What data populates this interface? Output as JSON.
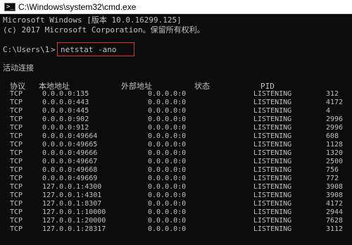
{
  "window": {
    "title": "C:\\Windows\\system32\\cmd.exe",
    "icon": "console-icon"
  },
  "console": {
    "banner_line1": "Microsoft Windows [版本 10.0.16299.125]",
    "banner_line2": "(c) 2017 Microsoft Corporation。保留所有权利。",
    "prompt": "C:\\Users\\1",
    "command": "netstat -ano",
    "section_title": "活动连接",
    "headers": {
      "proto": "协议",
      "local": "本地地址",
      "foreign": "外部地址",
      "state": "状态",
      "pid": "PID"
    },
    "rows": [
      {
        "proto": "TCP",
        "local": "0.0.0.0:135",
        "foreign": "0.0.0.0:0",
        "state": "LISTENING",
        "pid": "312"
      },
      {
        "proto": "TCP",
        "local": "0.0.0.0:443",
        "foreign": "0.0.0.0:0",
        "state": "LISTENING",
        "pid": "4172"
      },
      {
        "proto": "TCP",
        "local": "0.0.0.0:445",
        "foreign": "0.0.0.0:0",
        "state": "LISTENING",
        "pid": "4"
      },
      {
        "proto": "TCP",
        "local": "0.0.0.0:902",
        "foreign": "0.0.0.0:0",
        "state": "LISTENING",
        "pid": "2996"
      },
      {
        "proto": "TCP",
        "local": "0.0.0.0:912",
        "foreign": "0.0.0.0:0",
        "state": "LISTENING",
        "pid": "2996"
      },
      {
        "proto": "TCP",
        "local": "0.0.0.0:49664",
        "foreign": "0.0.0.0:0",
        "state": "LISTENING",
        "pid": "608"
      },
      {
        "proto": "TCP",
        "local": "0.0.0.0:49665",
        "foreign": "0.0.0.0:0",
        "state": "LISTENING",
        "pid": "1128"
      },
      {
        "proto": "TCP",
        "local": "0.0.0.0:49666",
        "foreign": "0.0.0.0:0",
        "state": "LISTENING",
        "pid": "1320"
      },
      {
        "proto": "TCP",
        "local": "0.0.0.0:49667",
        "foreign": "0.0.0.0:0",
        "state": "LISTENING",
        "pid": "2500"
      },
      {
        "proto": "TCP",
        "local": "0.0.0.0:49668",
        "foreign": "0.0.0.0:0",
        "state": "LISTENING",
        "pid": "756"
      },
      {
        "proto": "TCP",
        "local": "0.0.0.0:49669",
        "foreign": "0.0.0.0:0",
        "state": "LISTENING",
        "pid": "772"
      },
      {
        "proto": "TCP",
        "local": "127.0.0.1:4300",
        "foreign": "0.0.0.0:0",
        "state": "LISTENING",
        "pid": "3908"
      },
      {
        "proto": "TCP",
        "local": "127.0.0.1:4301",
        "foreign": "0.0.0.0:0",
        "state": "LISTENING",
        "pid": "3908"
      },
      {
        "proto": "TCP",
        "local": "127.0.0.1:8307",
        "foreign": "0.0.0.0:0",
        "state": "LISTENING",
        "pid": "4172"
      },
      {
        "proto": "TCP",
        "local": "127.0.0.1:10000",
        "foreign": "0.0.0.0:0",
        "state": "LISTENING",
        "pid": "2944"
      },
      {
        "proto": "TCP",
        "local": "127.0.0.1:20000",
        "foreign": "0.0.0.0:0",
        "state": "LISTENING",
        "pid": "7628"
      },
      {
        "proto": "TCP",
        "local": "127.0.0.1:28317",
        "foreign": "0.0.0.0:0",
        "state": "LISTENING",
        "pid": "3112"
      }
    ]
  },
  "colors": {
    "console_bg": "#0c0c0c",
    "console_text": "#c0c0c0",
    "highlight_box": "#e3322d"
  }
}
